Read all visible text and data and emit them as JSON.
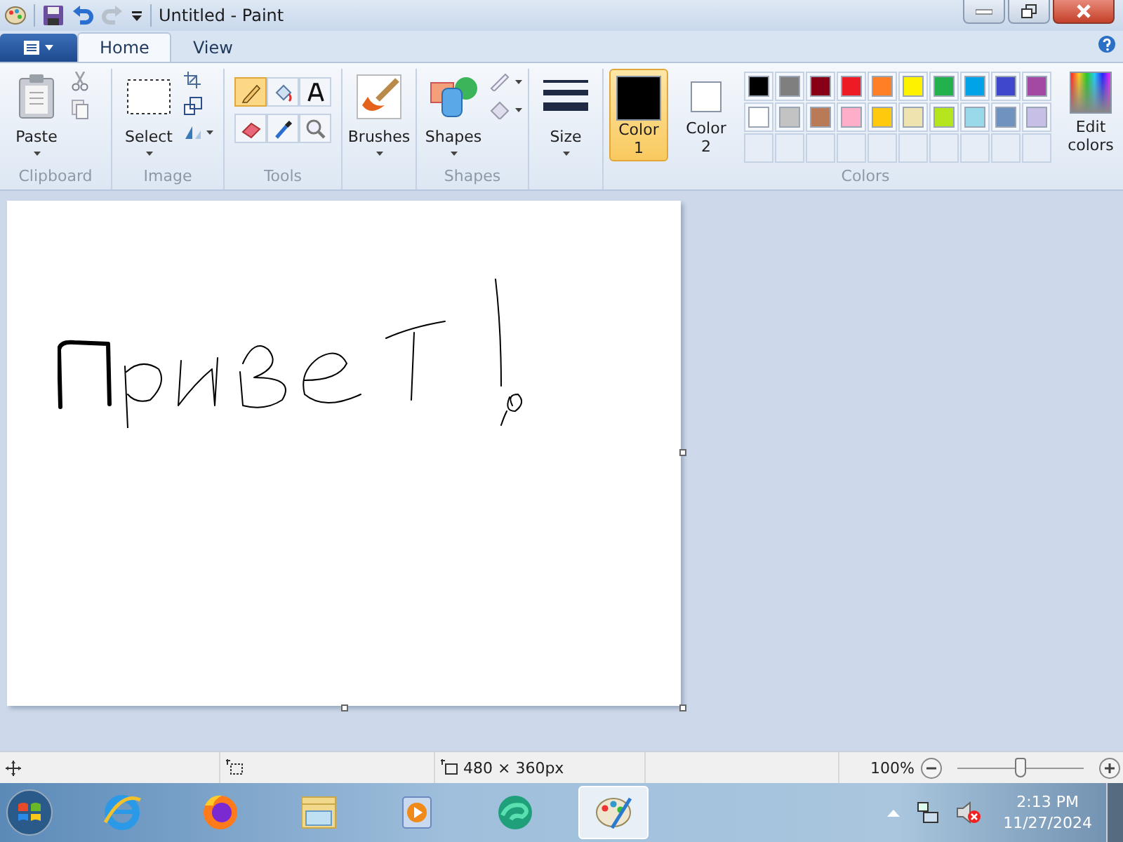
{
  "window": {
    "title": "Untitled - Paint"
  },
  "ribbon_tabs": [
    {
      "label": "Home",
      "selected": true
    },
    {
      "label": "View",
      "selected": false
    }
  ],
  "clipboard": {
    "label": "Clipboard",
    "paste": "Paste"
  },
  "image": {
    "label": "Image",
    "select": "Select"
  },
  "tools": {
    "label": "Tools",
    "items": [
      {
        "kind": "pencil",
        "selected": true
      },
      {
        "kind": "fill",
        "selected": false
      },
      {
        "kind": "text",
        "selected": false
      },
      {
        "kind": "eraser",
        "selected": false
      },
      {
        "kind": "picker",
        "selected": false
      },
      {
        "kind": "magnifier",
        "selected": false
      }
    ]
  },
  "brushes": {
    "label": "Brushes"
  },
  "shapes": {
    "label": "Shapes",
    "group_label": "Shapes"
  },
  "size": {
    "label": "Size"
  },
  "colors": {
    "label": "Colors",
    "color1": {
      "label": "Color 1",
      "color": "#000000",
      "selected": true
    },
    "color2": {
      "label": "Color 2",
      "color": "#ffffff",
      "selected": false
    },
    "palette": [
      {
        "color": "#000000"
      },
      {
        "color": "#7f7f7f"
      },
      {
        "color": "#880015"
      },
      {
        "color": "#ed1c24"
      },
      {
        "color": "#ff7f27"
      },
      {
        "color": "#fff200"
      },
      {
        "color": "#22b14c"
      },
      {
        "color": "#00a2e8"
      },
      {
        "color": "#3f48cc"
      },
      {
        "color": "#a349a4"
      },
      {
        "color": "#ffffff"
      },
      {
        "color": "#c3c3c3"
      },
      {
        "color": "#b97a57"
      },
      {
        "color": "#ffaec9"
      },
      {
        "color": "#ffc90e"
      },
      {
        "color": "#efe4b0"
      },
      {
        "color": "#b5e61d"
      },
      {
        "color": "#99d9ea"
      },
      {
        "color": "#7092be"
      },
      {
        "color": "#c8bfe7"
      }
    ],
    "edit": "Edit colors"
  },
  "status_bar": {
    "canvas_size": "480 × 360px",
    "zoom": "100%",
    "zoom_slider": {
      "level": 0.5
    }
  },
  "taskbar": {
    "apps": [
      {
        "kind": "ie",
        "selected": false
      },
      {
        "kind": "firefox",
        "selected": false
      },
      {
        "kind": "explorer",
        "selected": false
      },
      {
        "kind": "media",
        "selected": false
      },
      {
        "kind": "edge",
        "selected": false
      },
      {
        "kind": "paint",
        "selected": true
      }
    ],
    "time": "2:13 PM",
    "date": "11/27/2024"
  }
}
